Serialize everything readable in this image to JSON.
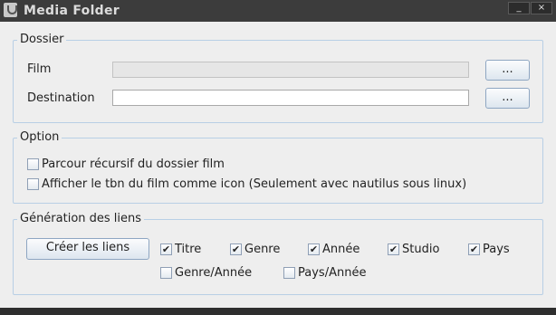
{
  "window": {
    "title": "Media Folder",
    "minimize": "_",
    "close": "×"
  },
  "dossier": {
    "legend": "Dossier",
    "film_label": "Film",
    "film_value": "",
    "film_browse": "...",
    "destination_label": "Destination",
    "destination_value": "",
    "destination_browse": "..."
  },
  "option": {
    "legend": "Option",
    "recursive_label": "Parcour récursif du dossier film",
    "recursive_checked": false,
    "thumbnail_label": "Afficher le tbn du film comme icon (Seulement avec nautilus sous linux)",
    "thumbnail_checked": false
  },
  "generation": {
    "legend": "Génération des liens",
    "create_button": "Créer les liens",
    "checkboxes": [
      {
        "label": "Titre",
        "checked": true
      },
      {
        "label": "Genre",
        "checked": true
      },
      {
        "label": "Année",
        "checked": true
      },
      {
        "label": "Studio",
        "checked": true
      },
      {
        "label": "Pays",
        "checked": true
      },
      {
        "label": "Genre/Année",
        "checked": false
      },
      {
        "label": "Pays/Année",
        "checked": false
      }
    ]
  }
}
